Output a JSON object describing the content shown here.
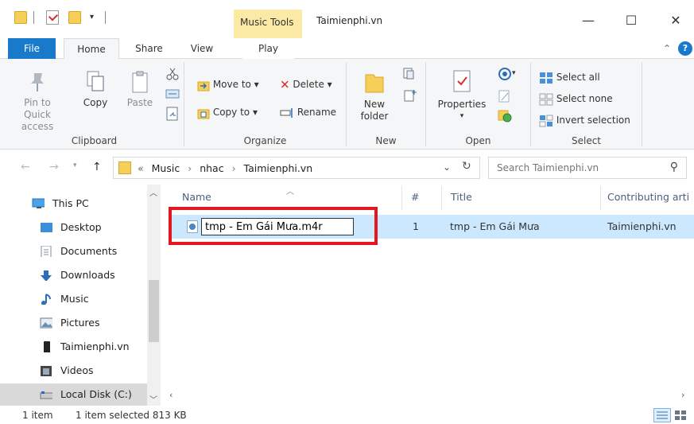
{
  "titlebar": {
    "context_tab": "Music Tools",
    "window_title": "Taimienphi.vn",
    "minimize": "—",
    "maximize": "☐",
    "close": "✕"
  },
  "tabs": {
    "file": "File",
    "home": "Home",
    "share": "Share",
    "view": "View",
    "play": "Play"
  },
  "ribbon": {
    "clipboard": {
      "label": "Clipboard",
      "pin": [
        "Pin to Quick",
        "access"
      ],
      "copy": "Copy",
      "paste": "Paste"
    },
    "organize": {
      "label": "Organize",
      "move_to": "Move to ▾",
      "copy_to": "Copy to ▾",
      "delete": "Delete ▾",
      "rename": "Rename"
    },
    "new": {
      "label": "New",
      "new_folder": [
        "New",
        "folder"
      ]
    },
    "open": {
      "label": "Open",
      "properties": "Properties"
    },
    "select": {
      "label": "Select",
      "select_all": "Select all",
      "select_none": "Select none",
      "invert": "Invert selection"
    }
  },
  "address": {
    "overflow": "«",
    "path": [
      "Music",
      "nhac",
      "Taimienphi.vn"
    ],
    "search_placeholder": "Search Taimienphi.vn"
  },
  "nav": {
    "items": [
      {
        "label": "This PC",
        "icon": "monitor-icon"
      },
      {
        "label": "Desktop",
        "icon": "desktop-icon"
      },
      {
        "label": "Documents",
        "icon": "documents-icon"
      },
      {
        "label": "Downloads",
        "icon": "download-arrow-icon"
      },
      {
        "label": "Music",
        "icon": "music-note-icon"
      },
      {
        "label": "Pictures",
        "icon": "pictures-icon"
      },
      {
        "label": "Taimienphi.vn",
        "icon": "phone-icon"
      },
      {
        "label": "Videos",
        "icon": "film-icon"
      },
      {
        "label": "Local Disk (C:)",
        "icon": "disk-icon"
      }
    ]
  },
  "filelist": {
    "columns": {
      "name": "Name",
      "number": "#",
      "title": "Title",
      "artist": "Contributing arti"
    },
    "rows": [
      {
        "name": "tmp - Em Gái Mưa.m4r",
        "number": "1",
        "title": "tmp - Em Gái Mưa",
        "artist": "Taimienphi.vn"
      }
    ]
  },
  "status": {
    "count": "1 item",
    "selected": "1 item selected  813 KB"
  },
  "colors": {
    "accent": "#1979ca",
    "context_tab": "#fbeaa6",
    "selection": "#cce8ff",
    "highlight_box": "#e3171f"
  }
}
